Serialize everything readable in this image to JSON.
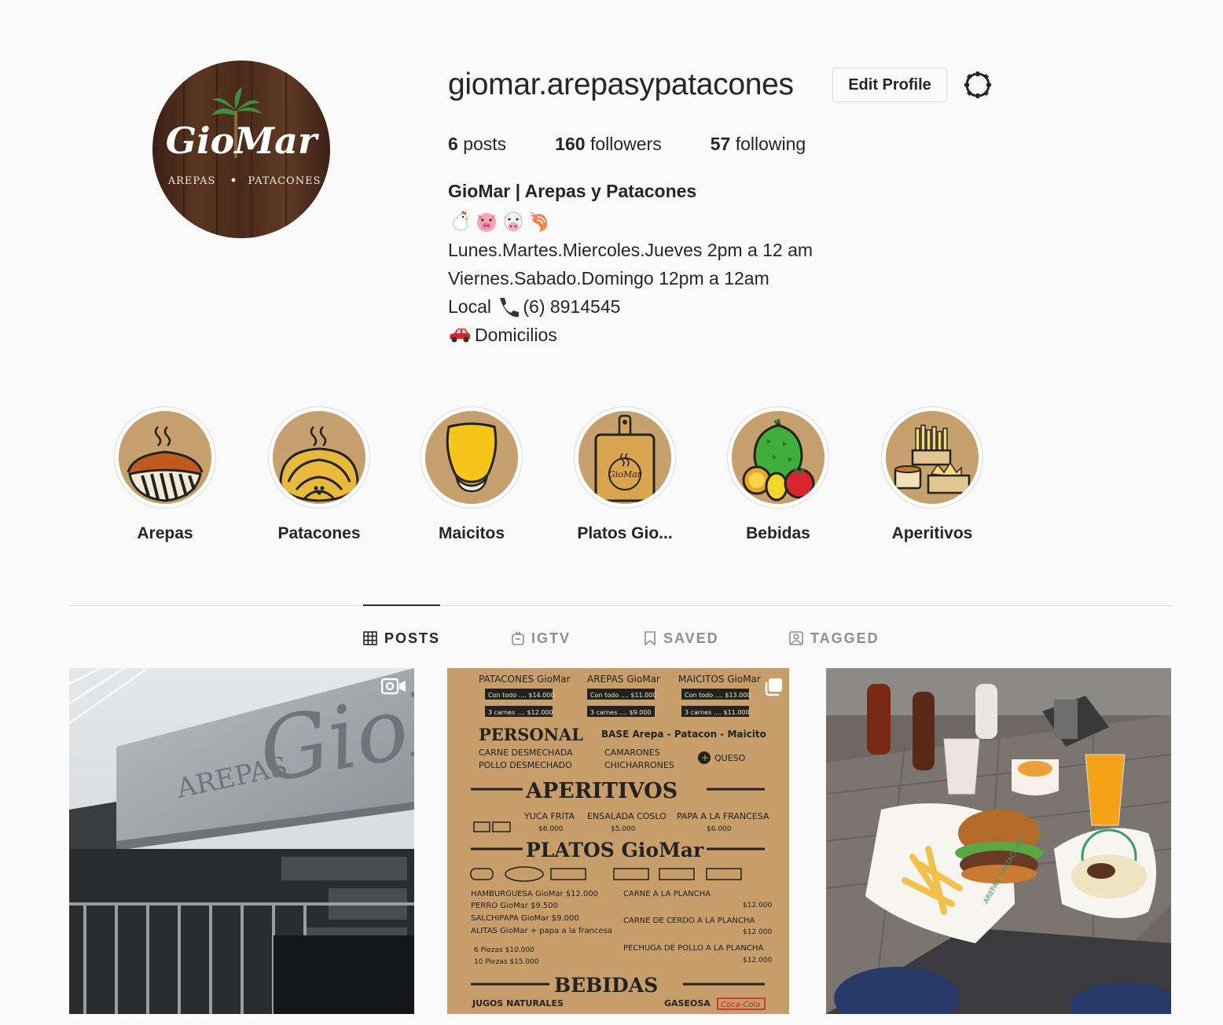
{
  "profile": {
    "username": "giomar.arepasypatacones",
    "edit_label": "Edit Profile",
    "avatar": {
      "brand": "GioMar",
      "left_word": "AREPAS",
      "right_word": "PATACONES"
    },
    "stats": {
      "posts_count": "6",
      "posts_label": "posts",
      "followers_count": "160",
      "followers_label": "followers",
      "following_count": "57",
      "following_label": "following"
    },
    "full_name": "GioMar | Arepas y Patacones",
    "bio": {
      "emoji_line": [
        "chicken",
        "pig-face",
        "cow-face",
        "shrimp"
      ],
      "line1": "Lunes.Martes.Miercoles.Jueves 2pm a 12 am",
      "line2": "Viernes.Sabado.Domingo 12pm a 12am",
      "line3_prefix": "Local",
      "line3_phone": "(6) 8914545",
      "line4": "Domicilios"
    }
  },
  "highlights": [
    {
      "label": "Arepas",
      "icon": "arepa-icon"
    },
    {
      "label": "Patacones",
      "icon": "patacon-icon"
    },
    {
      "label": "Maicitos",
      "icon": "corn-icon"
    },
    {
      "label": "Platos Gio...",
      "icon": "cutting-board-icon"
    },
    {
      "label": "Bebidas",
      "icon": "fruits-icon"
    },
    {
      "label": "Aperitivos",
      "icon": "fries-icon"
    }
  ],
  "tabs": [
    {
      "label": "POSTS",
      "icon": "grid-icon",
      "active": true
    },
    {
      "label": "IGTV",
      "icon": "igtv-icon",
      "active": false
    },
    {
      "label": "SAVED",
      "icon": "bookmark-icon",
      "active": false
    },
    {
      "label": "TAGGED",
      "icon": "tag-icon",
      "active": false
    }
  ],
  "posts": {
    "sign": {
      "left_word": "AREPAS",
      "brand": "GioMar"
    },
    "menu": {
      "col_titles": [
        "PATACONES GioMar",
        "AREPAS GioMar",
        "MAICITOS GioMar"
      ],
      "prices_full": [
        "Con todo .... $14.000",
        "Con todo .... $11.000",
        "Con todo .... $13.000"
      ],
      "prices_3": [
        "3 carnes .... $12.000",
        "3 carnes .... $9.000",
        "3 carnes .... $11.000"
      ],
      "personal": "PERSONAL",
      "base": "BASE Arepa - Patacon - Maicito",
      "personal_items": [
        "CARNE DESMECHADA",
        "POLLO DESMECHADO",
        "CAMARONES",
        "CHICHARRONES"
      ],
      "queso": "QUESO",
      "aperitivos": "APERITIVOS",
      "aperitivos_items": [
        "YUCA FRITA",
        "ENSALADA COSLO",
        "PAPA A LA FRANCESA"
      ],
      "aperitivos_prices": [
        "$6.000",
        "$5.000",
        "$6.000"
      ],
      "platos": "PLATOS GioMar",
      "platos_left": [
        "HAMBURGUESA GioMar $12.000",
        "PERRO GioMar $9.500",
        "SALCHIPAPA GioMar $9.000",
        "ALITAS GioMar + papa a la francesa",
        "6 Piezas $10.000",
        "10 Piezas $15.000"
      ],
      "platos_right": [
        "CARNE A LA PLANCHA",
        "CARNE DE CERDO A LA PLANCHA",
        "PECHUGA DE POLLO A LA PLANCHA"
      ],
      "platos_right_prices": [
        "$12.000",
        "$12.000",
        "$12.000"
      ],
      "bebidas": "BEBIDAS",
      "jugos": "JUGOS NATURALES",
      "gaseosa": "GASEOSA",
      "cola": "Coca-Cola"
    },
    "food": {
      "plate_text": "AREPAS Y PATACONES"
    }
  },
  "colors": {
    "text": "#262626",
    "muted": "#8e8e8e",
    "border": "#dbdbdb",
    "background": "#fafafa",
    "kraft": "#c6a06d",
    "wood": "#4a2c1c"
  }
}
